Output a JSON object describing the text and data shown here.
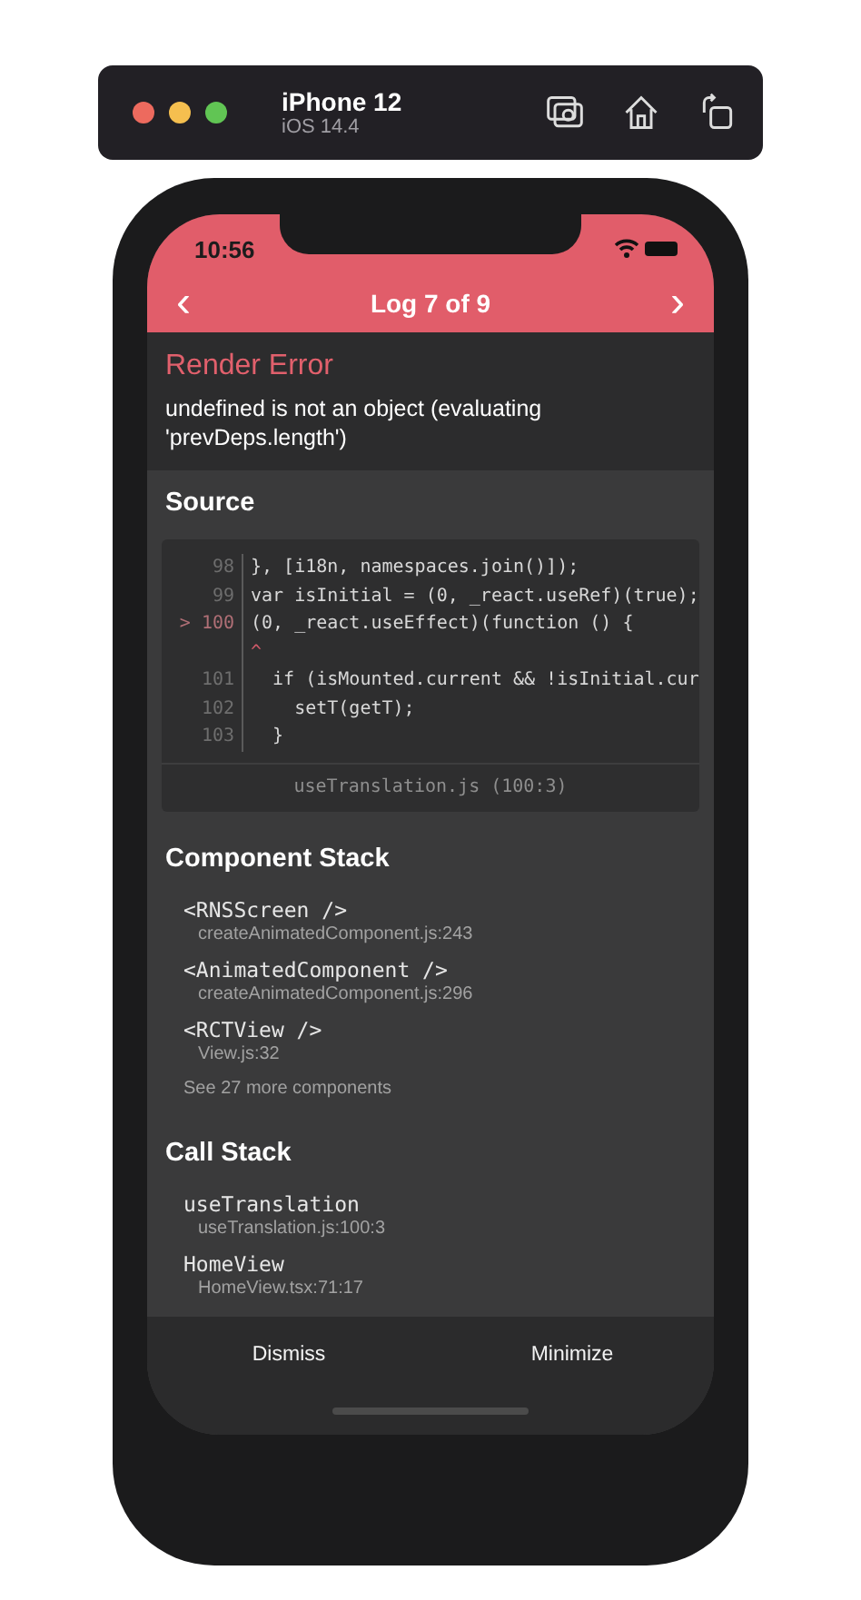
{
  "simulator": {
    "device": "iPhone 12",
    "os": "iOS 14.4"
  },
  "status_bar": {
    "time": "10:56"
  },
  "nav": {
    "prev": "‹",
    "title": "Log 7 of 9",
    "next": "›"
  },
  "error": {
    "title": "Render Error",
    "message": "undefined is not an object (evaluating 'prevDeps.length')"
  },
  "source": {
    "heading": "Source",
    "lines": [
      {
        "number": "98",
        "code": "}, [i18n, namespaces.join()]);"
      },
      {
        "number": "99",
        "code": "var isInitial = (0, _react.useRef)(true);"
      },
      {
        "number": "100",
        "code": "(0, _react.useEffect)(function () {",
        "marker": ">"
      },
      {
        "code": "^",
        "kind": "caret"
      },
      {
        "number": "101",
        "code": "  if (isMounted.current && !isInitial.cur"
      },
      {
        "number": "102",
        "code": "    setT(getT);"
      },
      {
        "number": "103",
        "code": "  }"
      }
    ],
    "file": "useTranslation.js (100:3)"
  },
  "component_stack": {
    "heading": "Component Stack",
    "frames": [
      {
        "name": "<RNSScreen />",
        "location": "createAnimatedComponent.js:243"
      },
      {
        "name": "<AnimatedComponent />",
        "location": "createAnimatedComponent.js:296"
      },
      {
        "name": "<RCTView />",
        "location": "View.js:32"
      }
    ],
    "more": "See 27 more components"
  },
  "call_stack": {
    "heading": "Call Stack",
    "frames": [
      {
        "name": "useTranslation",
        "location": "useTranslation.js:100:3"
      },
      {
        "name": "HomeView",
        "location": "HomeView.tsx:71:17"
      }
    ]
  },
  "footer": {
    "buttons": [
      "Dismiss",
      "Minimize"
    ]
  }
}
